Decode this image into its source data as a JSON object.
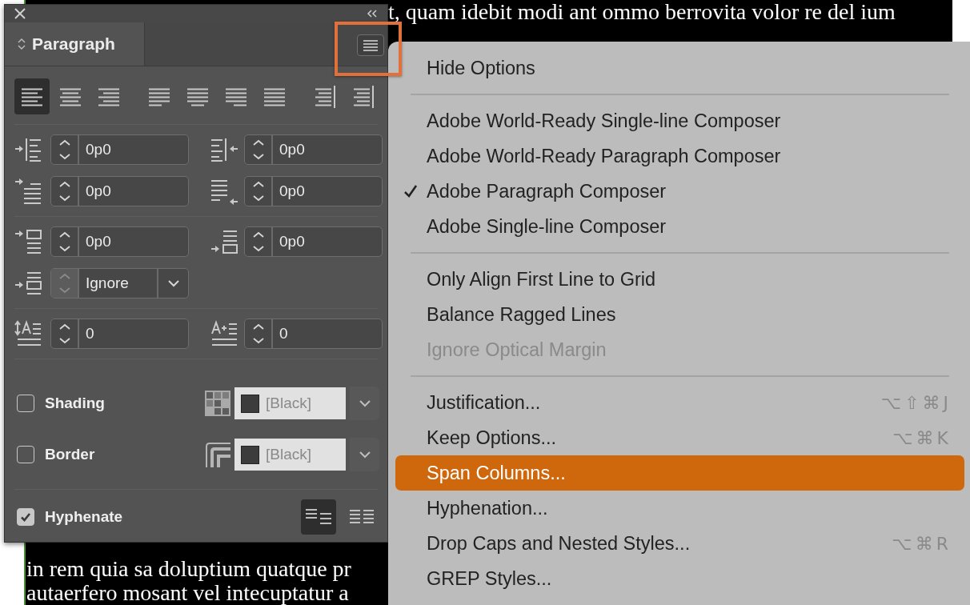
{
  "document": {
    "top_lines": [
      "t, quam idebit modi ant ommo berrovita volor re del ium"
    ],
    "bottom_lines": [
      "in rem quia sa doluptium quatque pr",
      "autaerfero mosant vel intecuptatur a"
    ]
  },
  "panel": {
    "title": "Paragraph",
    "alignment": [
      {
        "kind": "left",
        "selected": true
      },
      {
        "kind": "center",
        "selected": false
      },
      {
        "kind": "right",
        "selected": false
      },
      {
        "kind": "justleft",
        "selected": false
      },
      {
        "kind": "justcenter",
        "selected": false
      },
      {
        "kind": "justright",
        "selected": false
      },
      {
        "kind": "justall",
        "selected": false
      },
      {
        "kind": "towardspine",
        "selected": false
      },
      {
        "kind": "awayspine",
        "selected": false
      }
    ],
    "indents": [
      {
        "kind": "leftindent",
        "value": "0p0"
      },
      {
        "kind": "rightindent",
        "value": "0p0"
      },
      {
        "kind": "firstline",
        "value": "0p0"
      },
      {
        "kind": "lastline",
        "value": "0p0"
      }
    ],
    "spacing": [
      {
        "kind": "before",
        "value": "0p0"
      },
      {
        "kind": "after",
        "value": "0p0"
      }
    ],
    "grid_alignment": {
      "value": "Ignore",
      "stepper_disabled": true
    },
    "drop_caps": [
      {
        "kind": "caplines",
        "value": "0"
      },
      {
        "kind": "capchars",
        "value": "0"
      }
    ],
    "shading": {
      "label": "Shading",
      "checked": false,
      "swatch": "[Black]"
    },
    "border": {
      "label": "Border",
      "checked": false,
      "swatch": "[Black]"
    },
    "hyphenate": {
      "label": "Hyphenate",
      "checked": true
    },
    "composer_buttons": [
      {
        "selected": true
      },
      {
        "selected": false
      }
    ]
  },
  "menu": {
    "items": [
      {
        "kind": "item",
        "label": "Hide Options",
        "checked": false,
        "disabled": false,
        "selected": false
      },
      {
        "kind": "separator"
      },
      {
        "kind": "item",
        "label": "Adobe World-Ready Single-line Composer",
        "checked": false,
        "disabled": false,
        "selected": false
      },
      {
        "kind": "item",
        "label": "Adobe World-Ready Paragraph Composer",
        "checked": false,
        "disabled": false,
        "selected": false
      },
      {
        "kind": "item",
        "label": "Adobe Paragraph Composer",
        "checked": true,
        "disabled": false,
        "selected": false
      },
      {
        "kind": "item",
        "label": "Adobe Single-line Composer",
        "checked": false,
        "disabled": false,
        "selected": false
      },
      {
        "kind": "separator"
      },
      {
        "kind": "item",
        "label": "Only Align First Line to Grid",
        "checked": false,
        "disabled": false,
        "selected": false
      },
      {
        "kind": "item",
        "label": "Balance Ragged Lines",
        "checked": false,
        "disabled": false,
        "selected": false
      },
      {
        "kind": "item",
        "label": "Ignore Optical Margin",
        "checked": false,
        "disabled": true,
        "selected": false
      },
      {
        "kind": "separator"
      },
      {
        "kind": "item",
        "label": "Justification...",
        "shortcut": "⌥⇧⌘J",
        "checked": false,
        "disabled": false,
        "selected": false
      },
      {
        "kind": "item",
        "label": "Keep Options...",
        "shortcut": "⌥⌘K",
        "checked": false,
        "disabled": false,
        "selected": false
      },
      {
        "kind": "item",
        "label": "Span Columns...",
        "checked": false,
        "disabled": false,
        "selected": true
      },
      {
        "kind": "item",
        "label": "Hyphenation...",
        "checked": false,
        "disabled": false,
        "selected": false
      },
      {
        "kind": "item",
        "label": "Drop Caps and Nested Styles...",
        "shortcut": "⌥⌘R",
        "checked": false,
        "disabled": false,
        "selected": false
      },
      {
        "kind": "item",
        "label": "GREP Styles...",
        "checked": false,
        "disabled": false,
        "selected": false
      }
    ]
  }
}
